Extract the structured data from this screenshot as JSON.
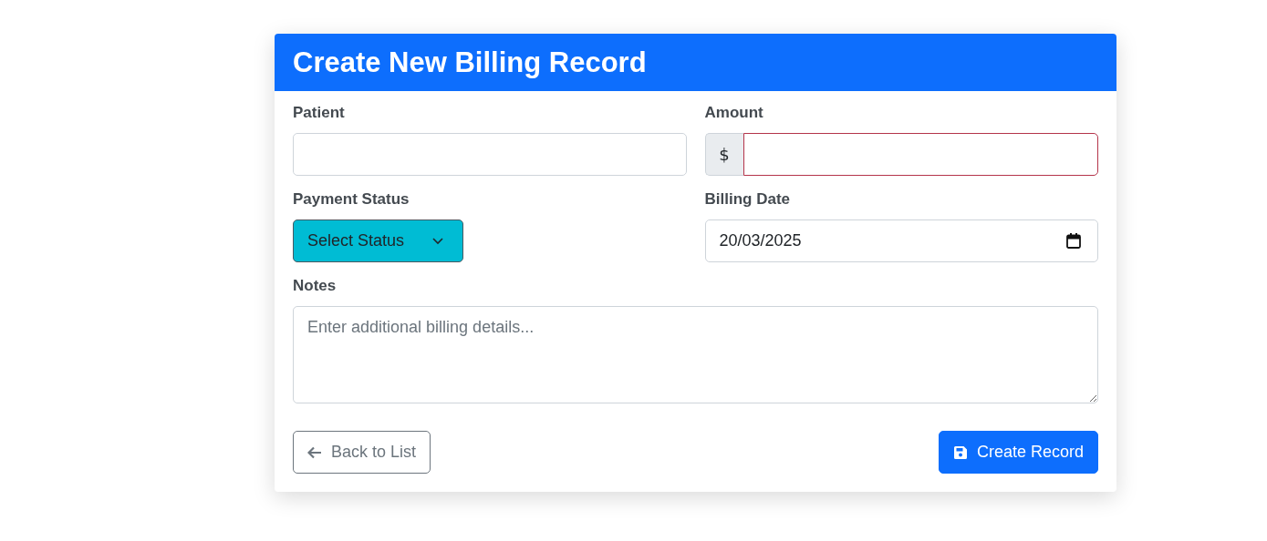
{
  "card": {
    "title": "Create New Billing Record"
  },
  "fields": {
    "patient": {
      "label": "Patient"
    },
    "amount": {
      "label": "Amount",
      "prefix": "$",
      "invalid": true
    },
    "payment_status": {
      "label": "Payment Status",
      "value": "Select Status"
    },
    "billing_date": {
      "label": "Billing Date",
      "value": "20/03/2025"
    },
    "notes": {
      "label": "Notes",
      "placeholder": "Enter additional billing details..."
    }
  },
  "buttons": {
    "back": "Back to List",
    "create": "Create Record"
  }
}
